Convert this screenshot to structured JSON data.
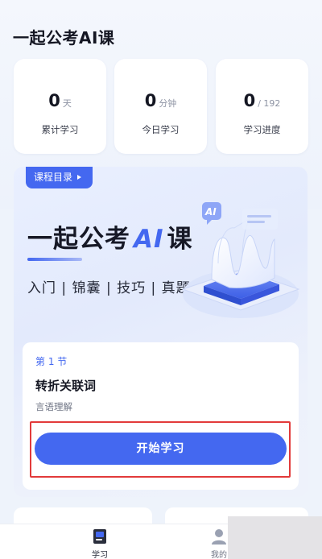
{
  "app": {
    "title": "一起公考AI课"
  },
  "stats": [
    {
      "value": "0",
      "unit": "天",
      "label": "累计学习"
    },
    {
      "value": "0",
      "unit": "分钟",
      "label": "今日学习"
    },
    {
      "value": "0",
      "unit": "/ 192",
      "label": "学习进度"
    }
  ],
  "course": {
    "catalog_label": "课程目录",
    "hero_title_pre": "一起公考",
    "hero_title_ai": "AI",
    "hero_title_post": "课",
    "hero_tags": "入门 | 锦囊 | 技巧 | 真题",
    "art_badge": "AI",
    "lesson": {
      "number_label": "第 1 节",
      "title": "转折关联词",
      "category": "言语理解"
    },
    "start_button_label": "开始学习"
  },
  "tabbar": {
    "items": [
      {
        "label": "学习",
        "icon": "book-icon",
        "active": true
      },
      {
        "label": "我的",
        "icon": "user-icon",
        "active": false
      }
    ]
  },
  "colors": {
    "accent": "#4468f0",
    "highlight": "#e23a3a",
    "background": "#eef3fb"
  }
}
